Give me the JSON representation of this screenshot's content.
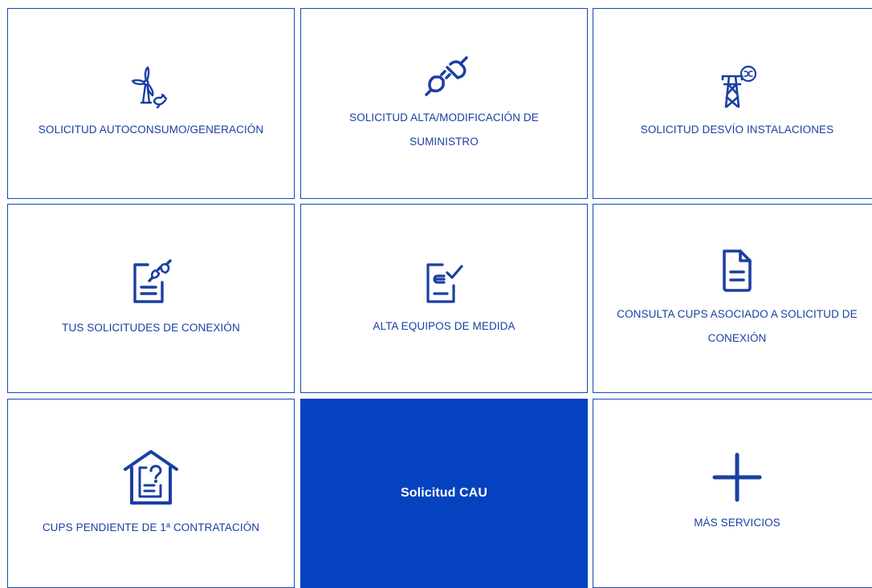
{
  "tiles": {
    "autoconsumo": {
      "label": "SOLICITUD AUTOCONSUMO/GENERACIÓN",
      "icon": "wind-turbine-plug-icon"
    },
    "alta_suministro": {
      "label": "SOLICITUD ALTA/MODIFICACIÓN DE SUMINISTRO",
      "icon": "plug-connection-icon"
    },
    "desvio": {
      "label": "SOLICITUD DESVÍO INSTALACIONES",
      "icon": "power-tower-shuffle-icon"
    },
    "tus_solicitudes": {
      "label": "TUS SOLICITUDES DE CONEXIÓN",
      "icon": "document-plug-icon"
    },
    "alta_equipos": {
      "label": "ALTA EQUIPOS DE MEDIDA",
      "icon": "document-check-icon"
    },
    "consulta_cups": {
      "label": "CONSULTA CUPS ASOCIADO A SOLICITUD DE CONEXIÓN",
      "icon": "document-icon"
    },
    "cups_pendiente": {
      "label": "CUPS PENDIENTE DE 1ª CONTRATACIÓN",
      "icon": "house-document-question-icon"
    },
    "solicitud_cau": {
      "label": "Solicitud CAU"
    },
    "mas_servicios": {
      "label": "MÁS SERVICIOS",
      "icon": "plus-icon"
    }
  },
  "colors": {
    "accent": "#1a3fa3",
    "border": "#1548b3",
    "highlight_bg": "#0542bf",
    "highlight_text": "#ffffff"
  }
}
